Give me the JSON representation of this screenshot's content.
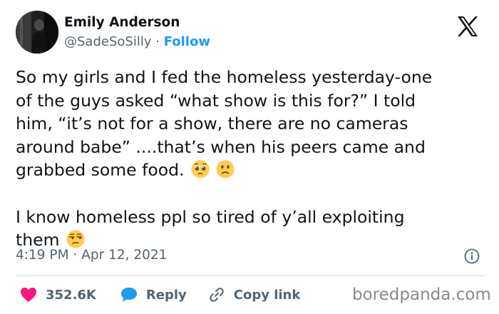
{
  "author": {
    "name": "Emily Anderson",
    "handle": "@SadeSoSilly",
    "separator": "·",
    "follow_label": "Follow"
  },
  "platform_icon": "x-logo-icon",
  "tweet": {
    "lines": [
      "So my girls and I fed the homeless yesterday-one",
      "of the guys asked “what show is this for?” I told",
      "him, “it’s not for a show, there are no cameras",
      "around babe” ....that’s when his peers came and",
      "grabbed some food.",
      "I know homeless ppl so tired of y’all exploiting",
      "them"
    ],
    "emojis": {
      "line5": [
        "pleading-face-emoji",
        "slightly-frowning-face-emoji"
      ],
      "line7": [
        "unamused-face-emoji"
      ]
    }
  },
  "timestamp": "4:19 PM · Apr 12, 2021",
  "actions": {
    "like_count": "352.6K",
    "reply_label": "Reply",
    "copy_link_label": "Copy link"
  },
  "colors": {
    "accent": "#1d9bf0",
    "like": "#f91880",
    "secondary_text": "#536471"
  },
  "watermark": "boredpanda.com"
}
